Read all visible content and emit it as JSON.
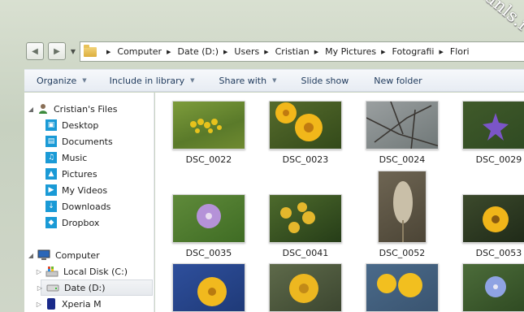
{
  "watermark": "cristianls.ro",
  "nav": {
    "breadcrumbs": [
      "Computer",
      "Date (D:)",
      "Users",
      "Cristian",
      "My Pictures",
      "Fotografii",
      "Flori"
    ]
  },
  "toolbar": {
    "organize": "Organize",
    "include": "Include in library",
    "share": "Share with",
    "slideshow": "Slide show",
    "newfolder": "New folder"
  },
  "tree": {
    "user_files": "Cristian's Files",
    "desktop": "Desktop",
    "documents": "Documents",
    "music": "Music",
    "pictures": "Pictures",
    "videos": "My Videos",
    "downloads": "Downloads",
    "dropbox": "Dropbox",
    "computer": "Computer",
    "local_disk": "Local Disk (C:)",
    "date_d": "Date (D:)",
    "xperia": "Xperia M"
  },
  "files": [
    "DSC_0022",
    "DSC_0023",
    "DSC_0024",
    "DSC_0029",
    "DSC_0035",
    "DSC_0041",
    "DSC_0052",
    "DSC_0053"
  ],
  "colors": {
    "accent": "#1e395b",
    "folder_icon": "#1a9ad6"
  }
}
